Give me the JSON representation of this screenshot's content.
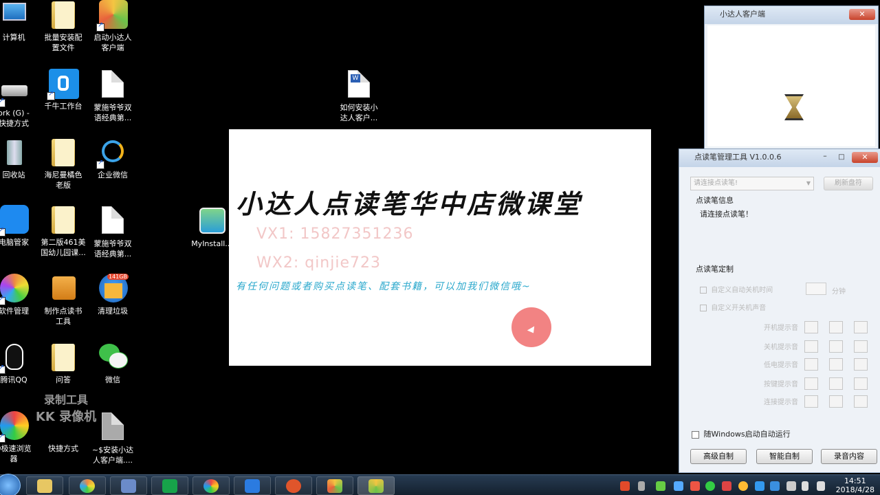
{
  "desktop": {
    "icons": [
      {
        "label": "计算机"
      },
      {
        "label": "批量安装配\n置文件"
      },
      {
        "label": "启动小达人\n客户端"
      },
      {
        "label": "ork (G) -\n快捷方式"
      },
      {
        "label": "千牛工作台"
      },
      {
        "label": "蒙施爷爷双\n语经典第..."
      },
      {
        "label": "如何安装小\n达人客户..."
      },
      {
        "label": "回收站"
      },
      {
        "label": "海尼曼橘色\n老版"
      },
      {
        "label": "企业微信"
      },
      {
        "label": "MyInstall..."
      },
      {
        "label": "电脑管家"
      },
      {
        "label": "第二版461美\n国幼儿园课..."
      },
      {
        "label": "蒙施爷爷双\n语经典第..."
      },
      {
        "label": "软件管理"
      },
      {
        "label": "制作点读书\n工具"
      },
      {
        "label": "清理垃圾"
      },
      {
        "label": "腾讯QQ"
      },
      {
        "label": "问答"
      },
      {
        "label": "微信"
      },
      {
        "label": "0极速浏览\n器"
      },
      {
        "label": "快捷方式"
      },
      {
        "label": "~$安装小达\n人客户端...."
      }
    ],
    "junk_badge": "141GB",
    "watermark_top": "录制工具",
    "watermark_bottom": "KK 录像机"
  },
  "splash": {
    "title": "小达人点读笔华中店微课堂",
    "vx": "VX1: 15827351236",
    "wx": "WX2: qinjie723",
    "info": "有任何问题或者购买点读笔、配套书籍，可以加我们微信哦~"
  },
  "client_window": {
    "title": "小达人客户端"
  },
  "manager_window": {
    "title": "点读笔管理工具 V1.0.0.6",
    "device_select": "请连接点读笔!",
    "refresh_button": "刷新盘符",
    "info_heading": "点读笔信息",
    "info_status": "请连接点读笔！",
    "custom_heading": "点读笔定制",
    "opt_power_off": "自定义自动关机时间",
    "opt_power_off_unit": "分钟",
    "opt_sound": "自定义开关机声音",
    "rows": [
      {
        "label": "开机提示音"
      },
      {
        "label": "关机提示音"
      },
      {
        "label": "低电提示音"
      },
      {
        "label": "按键提示音"
      },
      {
        "label": "连接提示音"
      }
    ],
    "autostart_label": "随Windows启动自动运行",
    "btn_advanced": "高级自制",
    "btn_smart": "智能自制",
    "btn_record": "录音内容"
  },
  "taskbar": {
    "clock_time": "14:51",
    "clock_date": "2018/4/28"
  }
}
